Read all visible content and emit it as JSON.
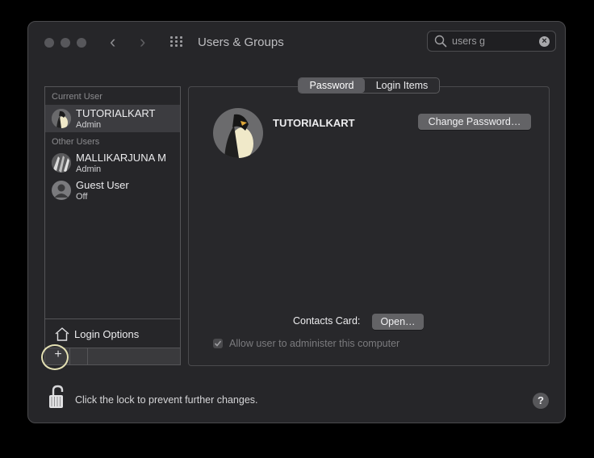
{
  "window": {
    "title": "Users & Groups",
    "nav_back": "‹",
    "nav_forward": "›",
    "search": {
      "value": "users g",
      "clear": "×"
    }
  },
  "sidebar": {
    "current_user_header": "Current User",
    "current_user": {
      "name": "TUTORIALKART",
      "role": "Admin"
    },
    "other_users_header": "Other Users",
    "other_users": [
      {
        "name": "MALLIKARJUNA M",
        "role": "Admin"
      },
      {
        "name": "Guest User",
        "role": "Off"
      }
    ],
    "login_options_label": "Login Options",
    "add_button": "+"
  },
  "tabs": {
    "password": "Password",
    "login_items": "Login Items"
  },
  "account": {
    "name": "TUTORIALKART",
    "change_password_button": "Change Password…",
    "contacts_card_label": "Contacts Card:",
    "open_button": "Open…",
    "allow_admin_label": "Allow user to administer this computer"
  },
  "footer": {
    "lock_text": "Click the lock to prevent further changes.",
    "help": "?"
  },
  "colors": {
    "window_bg": "#262629",
    "selected_row": "#3c3c40",
    "button_bg": "#636366",
    "highlight_circle": "#e3e0b3"
  }
}
